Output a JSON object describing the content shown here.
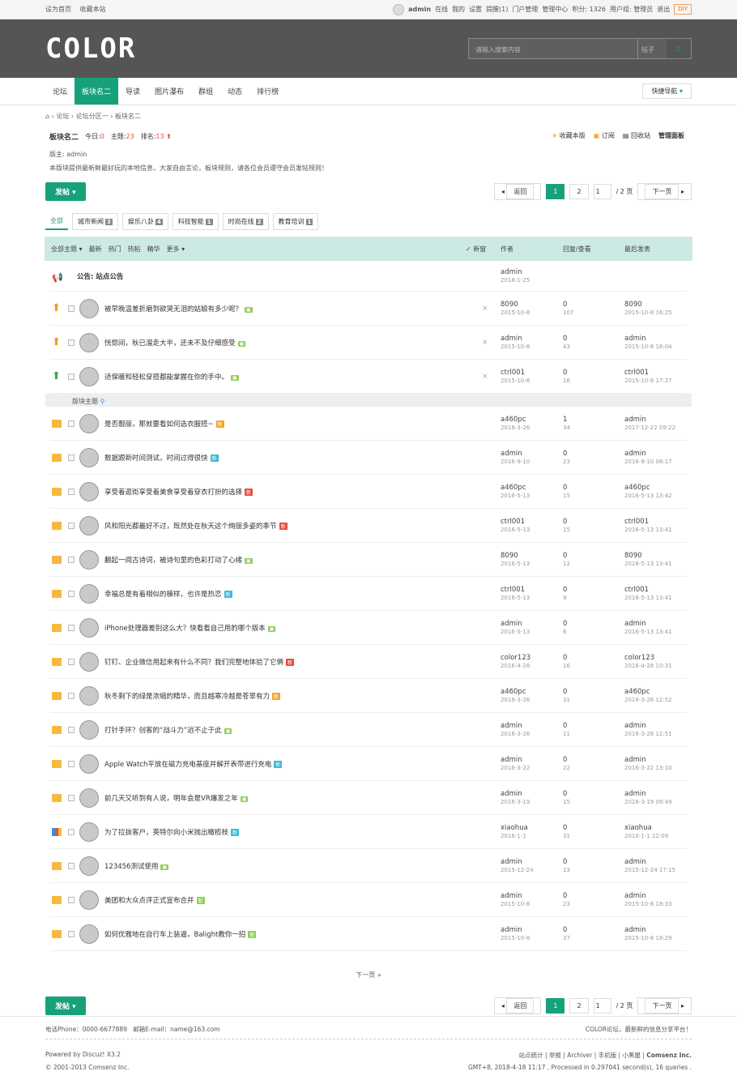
{
  "topbar": {
    "left": [
      "设为首页",
      "收藏本站"
    ],
    "right": [
      "admin",
      "在线",
      "我的",
      "设置",
      "提醒(1)",
      "门户管理",
      "管理中心",
      "积分: 1326",
      "用户组: 管理员",
      "退出"
    ],
    "diy": "DIY"
  },
  "header": {
    "logo": "COLOR",
    "search_placeholder": "请输入搜索内容",
    "search_type": "帖子"
  },
  "nav": {
    "items": [
      "论坛",
      "板块名二",
      "导读",
      "图片瀑布",
      "群组",
      "动态",
      "排行榜"
    ],
    "active": 1,
    "quick": "快捷导航"
  },
  "crumb": [
    "论坛",
    "论坛分区一",
    "板块名二"
  ],
  "forum": {
    "name": "板块名二",
    "today_label": "今日:",
    "today": "0",
    "topics_label": "主题:",
    "topics": "23",
    "rank_label": "排名:",
    "rank": "13",
    "actions": [
      "收藏本版",
      "订阅",
      "回收站",
      "管理面板"
    ],
    "mod": "版主: admin",
    "desc": "本版块提供最新鲜最好玩的本地信息，大家自由言论，板块规则，请各位会员遵守会员发帖规则！"
  },
  "post_btn": "发帖",
  "pager": {
    "back": "返回",
    "cur": "1",
    "p2": "2",
    "input": "1",
    "total": "/ 2 页",
    "next": "下一页"
  },
  "typetabs": [
    {
      "l": "全部",
      "n": ""
    },
    {
      "l": "城市新闻",
      "n": "3"
    },
    {
      "l": "娱乐八卦",
      "n": "4"
    },
    {
      "l": "科技智能",
      "n": "1"
    },
    {
      "l": "时尚在线",
      "n": "2"
    },
    {
      "l": "教育培训",
      "n": "1"
    }
  ],
  "thead": {
    "filters": [
      "全部主题",
      "最新",
      "热门",
      "热帖",
      "精华",
      "更多"
    ],
    "new": "新窗",
    "author": "作者",
    "reply": "回复/查看",
    "last": "最后发表"
  },
  "announce": {
    "title": "公告: 站点公告",
    "author": "admin",
    "date": "2018-1-25"
  },
  "sticky": [
    {
      "t": "被早晚温差折磨到欲哭无泪的姑娘有多少呢？",
      "a": "8090",
      "d": "2015-10-8",
      "r": "0",
      "v": "107",
      "la": "8090",
      "ld": "2015-10-8 16:25",
      "ico": "up1"
    },
    {
      "t": "恍惚间，秋已溜走大半，还未不及仔细感受",
      "a": "admin",
      "d": "2015-10-8",
      "r": "0",
      "v": "43",
      "la": "admin",
      "ld": "2015-10-8 16:04",
      "ico": "up1"
    },
    {
      "t": "适保暖和轻松穿搭都能掌握在你的手中。",
      "a": "ctrl001",
      "d": "2015-10-8",
      "r": "0",
      "v": "16",
      "la": "ctrl001",
      "ld": "2015-10-8 17:27",
      "ico": "up3"
    }
  ],
  "sep": "版块主题",
  "threads": [
    {
      "t": "是否靓丽，那就要看如何选衣服搭~",
      "b": "o",
      "a": "a460pc",
      "d": "2016-3-26",
      "r": "1",
      "v": "34",
      "la": "admin",
      "ld": "2017-12-22 09:22"
    },
    {
      "t": "数据跟新时间测试，时间过得很快",
      "b": "c",
      "a": "admin",
      "d": "2016-9-10",
      "r": "0",
      "v": "23",
      "la": "admin",
      "ld": "2016-9-10 08:17"
    },
    {
      "t": "享受着逛街享受着美食享受着穿衣打扮的选择",
      "b": "r",
      "a": "a460pc",
      "d": "2016-5-13",
      "r": "0",
      "v": "15",
      "la": "a460pc",
      "ld": "2016-5-13 13:42"
    },
    {
      "t": "风和阳光都最好不过，既然处在秋天这个绚丽多姿的季节",
      "b": "r",
      "a": "ctrl001",
      "d": "2016-5-13",
      "r": "0",
      "v": "15",
      "la": "ctrl001",
      "ld": "2016-5-13 13:41"
    },
    {
      "t": "翻起一阅古诗词，被诗句里的色彩打动了心绪",
      "b": "",
      "a": "8090",
      "d": "2016-5-13",
      "r": "0",
      "v": "12",
      "la": "8090",
      "ld": "2016-5-13 13:41"
    },
    {
      "t": "幸福总是有着相似的模样，也许是热恋",
      "b": "c",
      "a": "ctrl001",
      "d": "2016-5-13",
      "r": "0",
      "v": "9",
      "la": "ctrl001",
      "ld": "2016-5-13 13:41"
    },
    {
      "t": "iPhone处理器差别这么大？快看看自己用的哪个版本",
      "b": "",
      "a": "admin",
      "d": "2016-5-13",
      "r": "0",
      "v": "6",
      "la": "admin",
      "ld": "2016-5-13 13:41"
    },
    {
      "t": "钉钉、企业微信用起来有什么不同？我们完整地体验了它俩",
      "b": "r",
      "a": "color123",
      "d": "2016-4-28",
      "r": "0",
      "v": "16",
      "la": "color123",
      "ld": "2016-4-28 10:31"
    },
    {
      "t": "秋冬剩下的绿是浓缩的精华，而且越寒冷越是苍翠有力",
      "b": "o",
      "a": "a460pc",
      "d": "2016-3-26",
      "r": "0",
      "v": "31",
      "la": "a460pc",
      "ld": "2016-3-26 12:52"
    },
    {
      "t": "打针手环？创客的“战斗力”远不止于此",
      "b": "",
      "a": "admin",
      "d": "2016-3-26",
      "r": "0",
      "v": "11",
      "la": "admin",
      "ld": "2016-3-26 12:51"
    },
    {
      "t": "Apple Watch平放在磁力充电基座并解开表带进行充电",
      "b": "c",
      "a": "admin",
      "d": "2016-3-22",
      "r": "0",
      "v": "22",
      "la": "admin",
      "ld": "2016-3-22 13:10"
    },
    {
      "t": "前几天又听到有人说，明年会是VR爆发之年",
      "b": "",
      "a": "admin",
      "d": "2016-3-19",
      "r": "0",
      "v": "15",
      "la": "admin",
      "ld": "2016-3-19 09:49"
    },
    {
      "t": "为了拉拢客户，英特尔向小米抛出橄榄枝",
      "b": "c",
      "a": "xiaohua",
      "d": "2016-1-1",
      "r": "0",
      "v": "31",
      "la": "xiaohua",
      "ld": "2016-1-1 22:09",
      "ico": "bar"
    },
    {
      "t": "123456测试使用",
      "b": "",
      "a": "admin",
      "d": "2015-12-24",
      "r": "0",
      "v": "13",
      "la": "admin",
      "ld": "2015-12-24 17:15"
    },
    {
      "t": "美团和大众点评正式宣布合并",
      "b": "g",
      "a": "admin",
      "d": "2015-10-8",
      "r": "0",
      "v": "23",
      "la": "admin",
      "ld": "2015-10-8 18:33"
    },
    {
      "t": "如何优雅地在自行车上装逼，Balight教你一招",
      "b": "g",
      "a": "admin",
      "d": "2015-10-8",
      "r": "0",
      "v": "37",
      "la": "admin",
      "ld": "2015-10-8 18:29"
    }
  ],
  "next_page": "下一页 »",
  "footer": {
    "phone": "电话Phone：0000-6677889",
    "email": "邮箱E-mail：name@163.com",
    "slogan": "COLOR论坛，最新鲜的信息分享平台！",
    "powered": "Powered by Discuz! X3.2",
    "copy": "© 2001-2013 Comsenz Inc.",
    "links": [
      "站点统计",
      "举报",
      "Archiver",
      "手机版",
      "小黑屋",
      "Comsenz Inc."
    ],
    "gmt": "GMT+8, 2018-4-18 11:17 , Processed in 0.297041 second(s), 16 queries ."
  }
}
